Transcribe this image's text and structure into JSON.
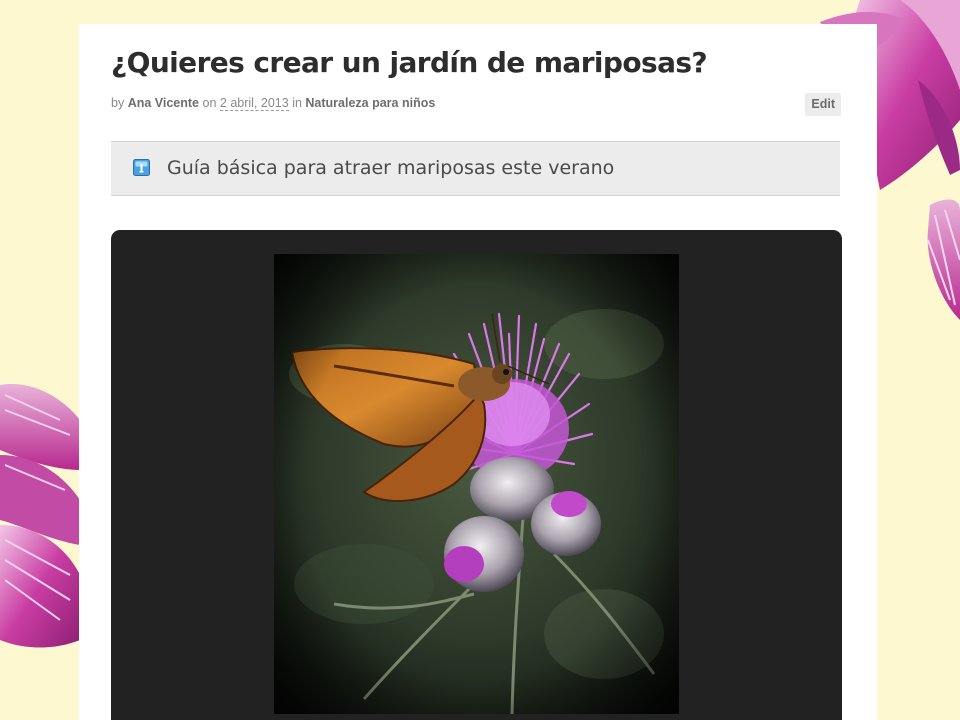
{
  "post": {
    "title": "¿Quieres crear un jardín de mariposas?",
    "meta": {
      "by_word": "by",
      "author": "Ana Vicente",
      "on_word": "on",
      "date": "2 abril, 2013",
      "in_word": "in",
      "category": "Naturaleza para niños"
    },
    "edit_label": "Edit",
    "subtitle": "Guía básica para atraer mariposas este verano",
    "subtitle_icon": "info-note-icon",
    "image": {
      "subject": "butterfly-on-thistle-photo"
    }
  },
  "colors": {
    "page_background": "#fdf8cf",
    "card_background": "#ffffff",
    "subtitle_background": "#ececec",
    "media_background": "#222222",
    "flower_pink": "#c93da3"
  }
}
